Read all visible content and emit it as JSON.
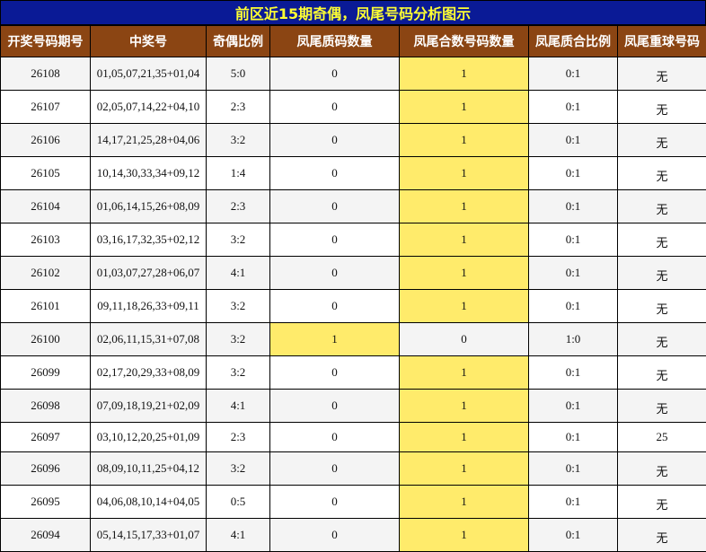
{
  "title": "前区近15期奇偶，凤尾号码分析图示",
  "colors": {
    "title_bg": "#0a1a96",
    "title_text": "#ffff33",
    "header_bg": "#8b4513",
    "header_text": "#ffffff",
    "highlight": "#ffeb6b"
  },
  "headers": [
    "开奖号码期号",
    "中奖号",
    "奇偶比例",
    "凤尾质码数量",
    "凤尾合数号码数量",
    "凤尾质合比例",
    "凤尾重球号码"
  ],
  "rows": [
    {
      "period": "26108",
      "numbers": "01,05,07,21,35+01,04",
      "odd_even": "5:0",
      "prime": "0",
      "composite": "1",
      "ratio": "0:1",
      "repeat": "无",
      "hl": "composite"
    },
    {
      "period": "26107",
      "numbers": "02,05,07,14,22+04,10",
      "odd_even": "2:3",
      "prime": "0",
      "composite": "1",
      "ratio": "0:1",
      "repeat": "无",
      "hl": "composite"
    },
    {
      "period": "26106",
      "numbers": "14,17,21,25,28+04,06",
      "odd_even": "3:2",
      "prime": "0",
      "composite": "1",
      "ratio": "0:1",
      "repeat": "无",
      "hl": "composite"
    },
    {
      "period": "26105",
      "numbers": "10,14,30,33,34+09,12",
      "odd_even": "1:4",
      "prime": "0",
      "composite": "1",
      "ratio": "0:1",
      "repeat": "无",
      "hl": "composite"
    },
    {
      "period": "26104",
      "numbers": "01,06,14,15,26+08,09",
      "odd_even": "2:3",
      "prime": "0",
      "composite": "1",
      "ratio": "0:1",
      "repeat": "无",
      "hl": "composite"
    },
    {
      "period": "26103",
      "numbers": "03,16,17,32,35+02,12",
      "odd_even": "3:2",
      "prime": "0",
      "composite": "1",
      "ratio": "0:1",
      "repeat": "无",
      "hl": "composite"
    },
    {
      "period": "26102",
      "numbers": "01,03,07,27,28+06,07",
      "odd_even": "4:1",
      "prime": "0",
      "composite": "1",
      "ratio": "0:1",
      "repeat": "无",
      "hl": "composite"
    },
    {
      "period": "26101",
      "numbers": "09,11,18,26,33+09,11",
      "odd_even": "3:2",
      "prime": "0",
      "composite": "1",
      "ratio": "0:1",
      "repeat": "无",
      "hl": "composite"
    },
    {
      "period": "26100",
      "numbers": "02,06,11,15,31+07,08",
      "odd_even": "3:2",
      "prime": "1",
      "composite": "0",
      "ratio": "1:0",
      "repeat": "无",
      "hl": "prime"
    },
    {
      "period": "26099",
      "numbers": "02,17,20,29,33+08,09",
      "odd_even": "3:2",
      "prime": "0",
      "composite": "1",
      "ratio": "0:1",
      "repeat": "无",
      "hl": "composite"
    },
    {
      "period": "26098",
      "numbers": "07,09,18,19,21+02,09",
      "odd_even": "4:1",
      "prime": "0",
      "composite": "1",
      "ratio": "0:1",
      "repeat": "无",
      "hl": "composite"
    },
    {
      "period": "26097",
      "numbers": "03,10,12,20,25+01,09",
      "odd_even": "2:3",
      "prime": "0",
      "composite": "1",
      "ratio": "0:1",
      "repeat": "25",
      "hl": "composite"
    },
    {
      "period": "26096",
      "numbers": "08,09,10,11,25+04,12",
      "odd_even": "3:2",
      "prime": "0",
      "composite": "1",
      "ratio": "0:1",
      "repeat": "无",
      "hl": "composite"
    },
    {
      "period": "26095",
      "numbers": "04,06,08,10,14+04,05",
      "odd_even": "0:5",
      "prime": "0",
      "composite": "1",
      "ratio": "0:1",
      "repeat": "无",
      "hl": "composite"
    },
    {
      "period": "26094",
      "numbers": "05,14,15,17,33+01,07",
      "odd_even": "4:1",
      "prime": "0",
      "composite": "1",
      "ratio": "0:1",
      "repeat": "无",
      "hl": "composite"
    }
  ]
}
